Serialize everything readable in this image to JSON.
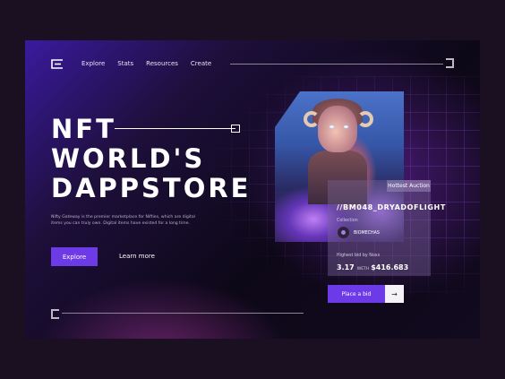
{
  "nav": {
    "items": [
      "Explore",
      "Stats",
      "Resources",
      "Create"
    ]
  },
  "hero": {
    "line1": "NFT",
    "line2": "WORLD'S",
    "line3": "DAPPSTORE",
    "description": "Nifty Gateway is the premier marketplace for Nifties, which are digital items you can truly own. Digital items have existed for a long time.",
    "explore_label": "Explore",
    "learn_more_label": "Learn more"
  },
  "auction": {
    "badge": "Hottest Auction",
    "title": "//BM048_DRYADOFLIGHT",
    "collection_label": "Collection",
    "collection_name": "BIOMECHAS",
    "bid_label": "Highest bid by Noxx",
    "bid_eth": "3.17",
    "bid_eth_unit": "WETH",
    "bid_usd": "$416.683",
    "place_bid_label": "Place a bid",
    "arrow_icon": "arrow-right-icon"
  },
  "colors": {
    "accent": "#6d3ae8",
    "background": "#1b1022"
  }
}
